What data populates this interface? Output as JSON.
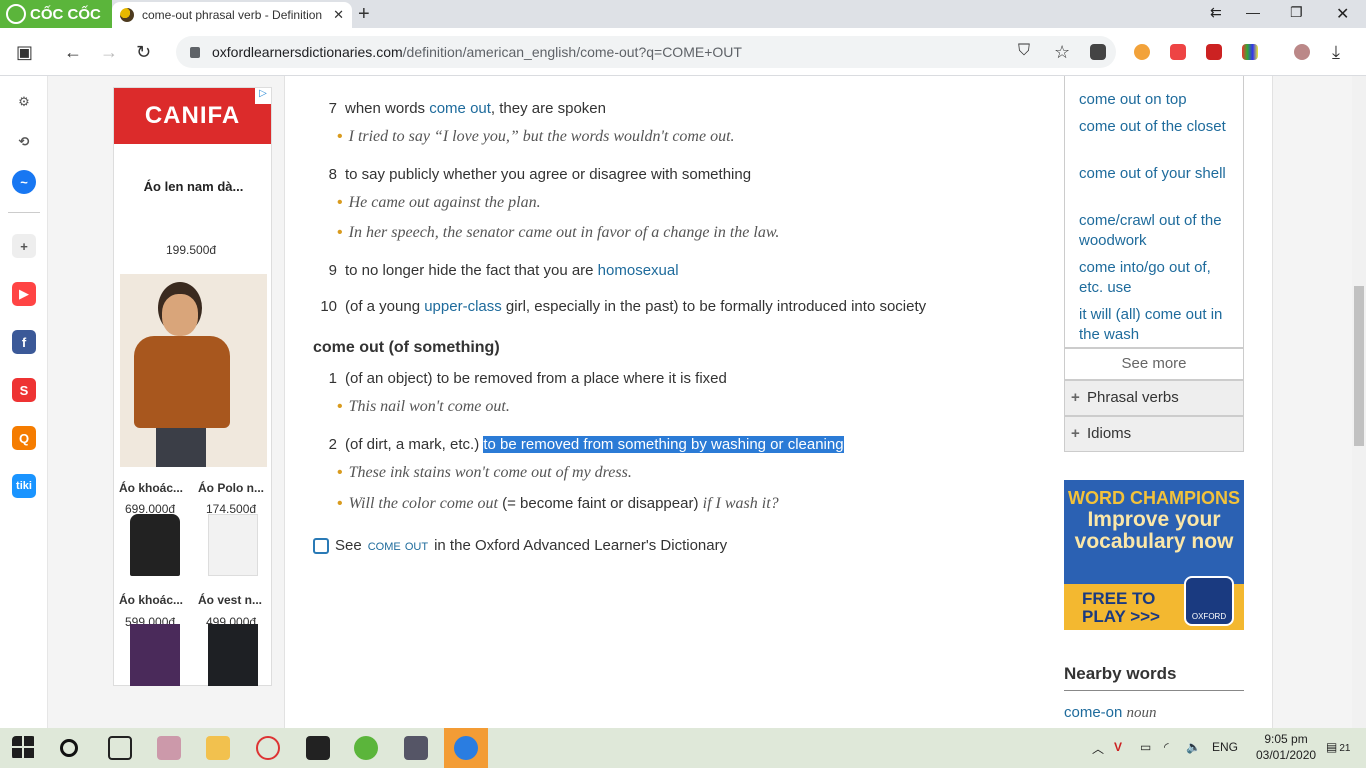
{
  "browser": {
    "brand": "CỐC CỐC",
    "tab_title": "come-out phrasal verb - Definition",
    "url_host": "oxfordlearnersdictionaries.com",
    "url_path": "/definition/american_english/come-out?q=COME+OUT"
  },
  "ad": {
    "brand": "CANIFA",
    "item1_name": "Áo len nam dà...",
    "item1_price": "199.500đ",
    "grid": [
      {
        "name": "Áo khoác...",
        "price": "699.000đ"
      },
      {
        "name": "Áo Polo n...",
        "price": "174.500đ"
      },
      {
        "name": "Áo khoác...",
        "price": "599.000đ"
      },
      {
        "name": "Áo vest n...",
        "price": "499.000đ"
      }
    ]
  },
  "entry": {
    "s7": {
      "num": "7",
      "pre": "when words ",
      "link": "come out",
      "post": ", they are spoken",
      "ex": "I tried to say “I love you,” but the words wouldn't come out."
    },
    "s8": {
      "num": "8",
      "text": "to say publicly whether you agree or disagree with something",
      "ex1": "He came out against the plan.",
      "ex2": "In her speech, the senator came out in favor of a change in the law."
    },
    "s9": {
      "num": "9",
      "pre": "to no longer hide the fact that you are ",
      "link": "homosexual"
    },
    "s10": {
      "num": "10",
      "pre": "(of a young ",
      "link": "upper-class",
      "post": " girl, especially in the past) to be formally introduced into society"
    },
    "sub_header": "come out (of something)",
    "t1": {
      "num": "1",
      "text": "(of an object) to be removed from a place where it is fixed",
      "ex": "This nail won't come out."
    },
    "t2": {
      "num": "2",
      "pre": "(of dirt, a mark, etc.) ",
      "highlight": "to be removed from something by washing or cleaning",
      "ex1": "These ink stains won't come out of my dress.",
      "ex2a": "Will the color come out",
      "ex2b": " (= become faint or disappear) ",
      "ex2c": "if I wash it?"
    },
    "see_pre": "See ",
    "see_link": "come out",
    "see_post": " in the Oxford Advanced Learner's Dictionary"
  },
  "right": {
    "idioms": [
      "come out on top",
      "come out of the closet",
      "come out of your shell",
      "come/crawl out of the woodwork",
      "come into/go out of, etc. use",
      "it will (all) come out in the wash"
    ],
    "see_more": "See more",
    "phrasal_verbs": "Phrasal verbs",
    "idioms_label": "Idioms",
    "wc_title": "WORD CHAMPIONS",
    "wc_tag": "Improve your vocabulary now",
    "wc_cta": "FREE TO PLAY >>>",
    "wc_brand": "OXFORD",
    "nearby_title": "Nearby words",
    "nearby_word": "come-on",
    "nearby_pos": "noun"
  },
  "taskbar": {
    "lang": "ENG",
    "time": "9:05 pm",
    "date": "03/01/2020",
    "notif": "21"
  }
}
